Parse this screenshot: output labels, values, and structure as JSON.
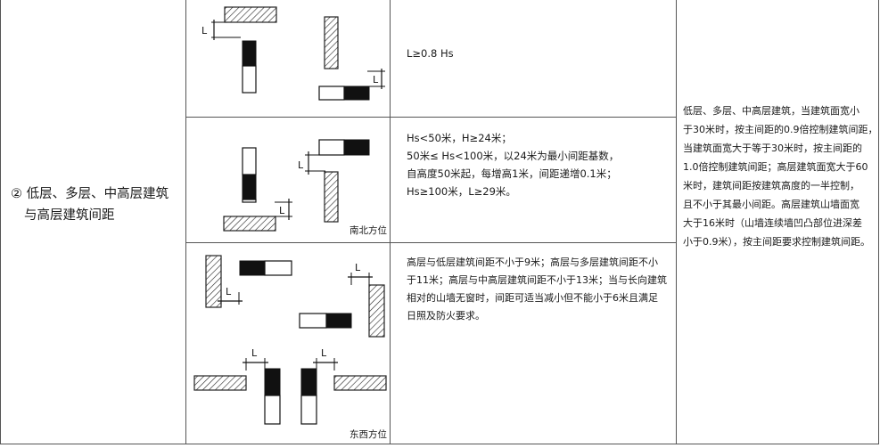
{
  "section": {
    "label_line1": "② 低层、多层、中高层建筑",
    "label_line2": "与高层建筑间距"
  },
  "rows": [
    {
      "rule": [
        "L≥0.8 Hs"
      ],
      "caption": ""
    },
    {
      "rule": [
        "Hs<50米，H≥24米；",
        "50米≤ Hs<100米，以24米为最小间距基数，",
        "自高度50米起，每增高1米，间距递增0.1米；",
        "Hs≥100米，L≥29米。"
      ],
      "caption": "南北方位"
    },
    {
      "rule": [
        "高层与低层建筑间距不小于9米；高层与多层建筑间距不小",
        "于11米；高层与中高层建筑间距不小于13米；当与长向建筑",
        "相对的山墙无窗时，间距可适当减小但不能小于6米且满足",
        "日照及防火要求。"
      ],
      "caption": "东西方位"
    }
  ],
  "note": [
    "低层、多层、中高层建筑，当建筑面宽小",
    "于30米时，按主间距的0.9倍控制建筑间距，",
    "当建筑面宽大于等于30米时，按主间距的",
    "1.0倍控制建筑间距；高层建筑面宽大于60",
    "米时，建筑间距按建筑高度的一半控制，",
    "且不小于其最小间距。高层建筑山墙面宽",
    "大于16米时（山墙连续墙凹凸部位进深差",
    "小于0.9米），按主间距要求控制建筑间距。"
  ],
  "dimension_label": "L"
}
